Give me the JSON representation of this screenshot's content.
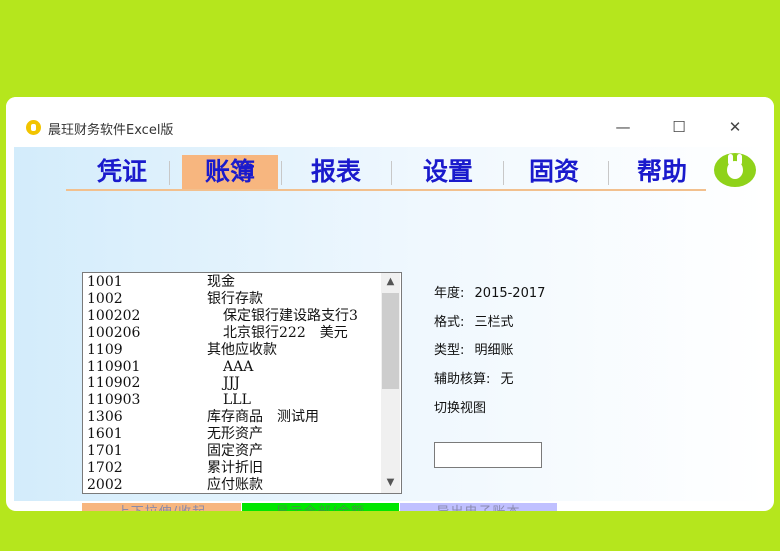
{
  "window": {
    "title": "晨玨财务软件Excel版",
    "controls": {
      "minimize": "—",
      "maximize": "☐",
      "close": "✕"
    }
  },
  "menu": {
    "items": [
      {
        "label": "凭证",
        "active": false
      },
      {
        "label": "账簿",
        "active": true
      },
      {
        "label": "报表",
        "active": false
      },
      {
        "label": "设置",
        "active": false
      },
      {
        "label": "固资",
        "active": false
      },
      {
        "label": "帮助",
        "active": false
      }
    ],
    "mascot_icon": "rabbit-mascot-icon"
  },
  "accounts": [
    {
      "code": "1001",
      "name": "现金"
    },
    {
      "code": "1002",
      "name": "银行存款"
    },
    {
      "code": "100202",
      "name": "保定银行建设路支行3"
    },
    {
      "code": "100206",
      "name": "北京银行222　美元"
    },
    {
      "code": "1109",
      "name": "其他应收款"
    },
    {
      "code": "110901",
      "name": "AAA"
    },
    {
      "code": "110902",
      "name": "JJJ"
    },
    {
      "code": "110903",
      "name": "LLL"
    },
    {
      "code": "1306",
      "name": "库存商品　测试用"
    },
    {
      "code": "1601",
      "name": "无形资产"
    },
    {
      "code": "1701",
      "name": "固定资产"
    },
    {
      "code": "1702",
      "name": "累计折旧"
    },
    {
      "code": "2002",
      "name": "应付账款"
    }
  ],
  "info": {
    "year_label": "年度:",
    "year_value": "2015-2017",
    "format_label": "格式:",
    "format_value": "三栏式",
    "type_label": "类型:",
    "type_value": "明细账",
    "aux_label": "辅助核算:",
    "aux_value": "无",
    "switch_view": "切换视图",
    "input_value": ""
  },
  "buttons": {
    "stretch": "上下拉伸/收起",
    "show_all": "显示全部/余额",
    "export": "导出电子账本"
  },
  "colors": {
    "background": "#b5e61d",
    "menu_text": "#1a1acc",
    "menu_active_bg": "#f7b67f",
    "btn_stretch": "#f7b67f",
    "btn_show_all": "#00e600",
    "btn_export": "#c0c0ff"
  }
}
